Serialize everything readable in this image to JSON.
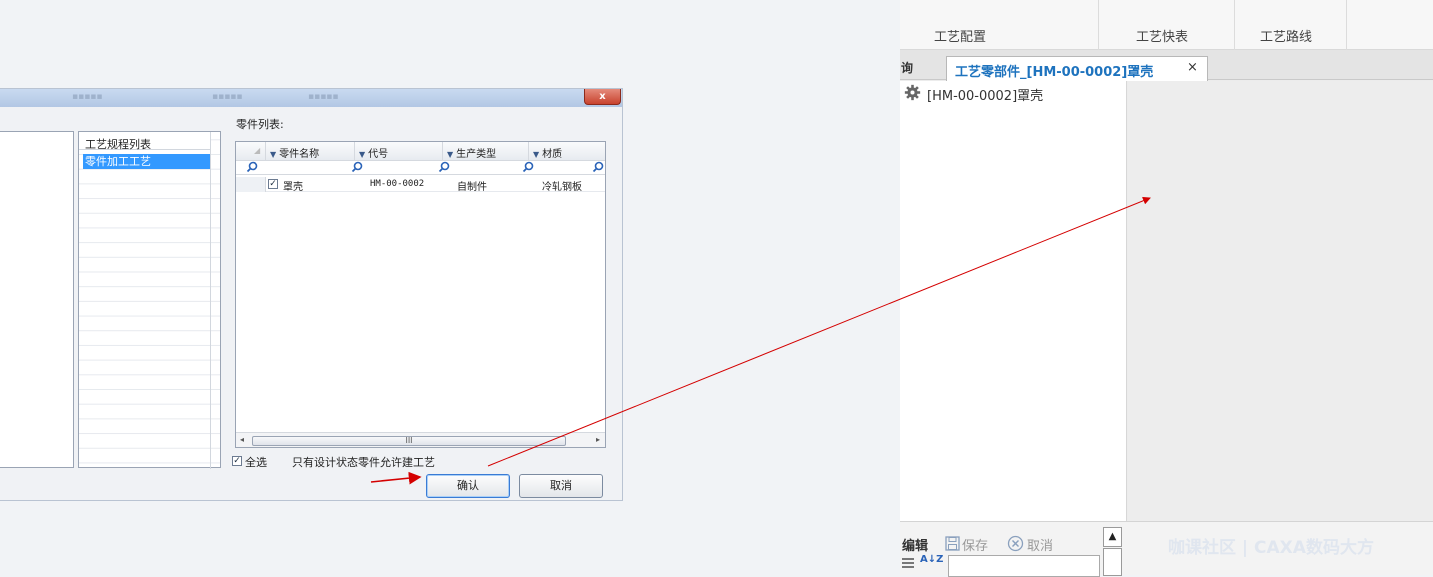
{
  "dialog": {
    "close_label": "x",
    "process_list": {
      "header": "工艺规程列表",
      "items": [
        "零件加工工艺"
      ]
    },
    "parts_list": {
      "title": "零件列表:",
      "columns": [
        "零件名称",
        "代号",
        "生产类型",
        "材质"
      ],
      "rows": [
        {
          "name": "罩壳",
          "code": "HM-00-0002",
          "type": "自制件",
          "material": "冷轧钢板",
          "checked": true
        }
      ],
      "scroll_mark": "III"
    },
    "select_all_label": "全选",
    "design_state_note": "只有设计状态零件允许建工艺",
    "ok_label": "确认",
    "cancel_label": "取消"
  },
  "app": {
    "top_tabs": [
      "工艺配置",
      "工艺快表",
      "工艺路线"
    ],
    "left_tab_partial": "询",
    "doc_tab": {
      "label": "工艺零部件_[HM-00-0002]罩壳",
      "close": "×"
    },
    "tree_item": "[HM-00-0002]罩壳",
    "bottom_toolbar": {
      "edit": "编辑",
      "save": "保存",
      "cancel": "取消",
      "sort_icon": "A↓Z"
    },
    "watermark": "咖课社区 | CAXA数码大方"
  },
  "colors": {
    "accent": "#1e73be",
    "selection": "#3399ff",
    "annotation_arrow": "#d40000"
  }
}
